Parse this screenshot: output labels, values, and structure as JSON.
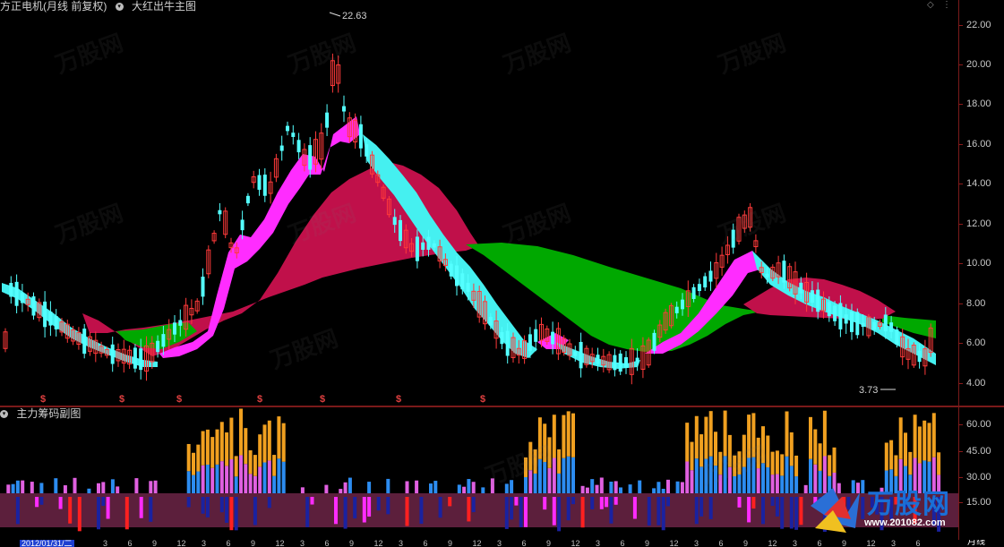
{
  "main_chart": {
    "stock_name": "方正电机(月线 前复权)",
    "indicator_name": "大红出牛主图",
    "price_ticks": [
      "22.00",
      "20.00",
      "18.00",
      "16.00",
      "14.00",
      "12.00",
      "10.00",
      "8.00",
      "6.00",
      "4.00"
    ],
    "high_label": "22.63",
    "low_label": "3.73",
    "signal_mark": "$"
  },
  "sub_chart": {
    "indicator_name": "主力筹码副图",
    "ticks": [
      "60.00",
      "45.00",
      "30.00",
      "15.00"
    ]
  },
  "bottom_bar": {
    "start_date": "2012/01/31/二",
    "period": "月线",
    "dates": [
      "3",
      "6",
      "9",
      "12",
      "3",
      "6",
      "9",
      "12",
      "3",
      "6",
      "9",
      "12",
      "3",
      "6",
      "9",
      "12",
      "3",
      "6",
      "9",
      "12",
      "3",
      "6",
      "9",
      "12",
      "3",
      "6",
      "9",
      "12",
      "3",
      "6",
      "9",
      "12",
      "3",
      "6"
    ]
  },
  "watermark": {
    "brand": "万股网",
    "url": "www.201082.com"
  },
  "colors": {
    "up_candle": "#ff3a3a",
    "down_candle": "#54ffff",
    "bear_band": "#c0104a",
    "bull_band": "#00a800",
    "magenta_band": "#ff2cff",
    "cyan_band": "#45f0f0",
    "axis_border": "#7a1a1a",
    "sub_fill": "#5c1f3c",
    "vol_orange": "#f0a020",
    "vol_blue": "#2c8cf0",
    "vol_pink": "#e060e0",
    "bar_red": "#ff2020",
    "bar_navy": "#1a22a0"
  }
}
